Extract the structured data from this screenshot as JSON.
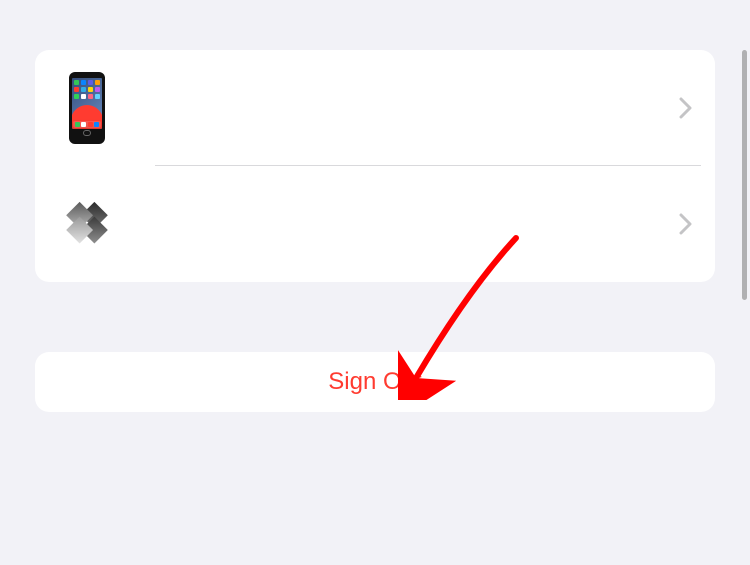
{
  "devices": [
    {
      "icon": "iphone-icon",
      "label": ""
    },
    {
      "icon": "bootcamp-diamond-icon",
      "label": ""
    }
  ],
  "signout": {
    "label": "Sign Out"
  },
  "annotation": {
    "arrow_color": "#ff0000"
  }
}
